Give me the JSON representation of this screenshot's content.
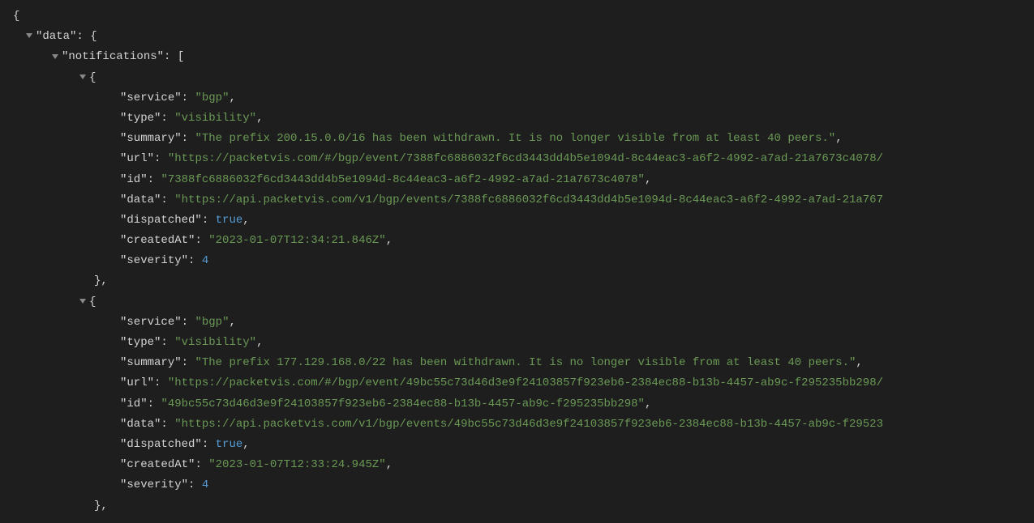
{
  "root_key": "data",
  "notifications_key": "notifications",
  "keys": {
    "service": "service",
    "type": "type",
    "summary": "summary",
    "url": "url",
    "id": "id",
    "data": "data",
    "dispatched": "dispatched",
    "createdAt": "createdAt",
    "severity": "severity"
  },
  "notifications": [
    {
      "service": "bgp",
      "type": "visibility",
      "summary": "The prefix 200.15.0.0/16 has been withdrawn. It is no longer visible from at least 40 peers.",
      "url": "https://packetvis.com/#/bgp/event/7388fc6886032f6cd3443dd4b5e1094d-8c44eac3-a6f2-4992-a7ad-21a7673c4078/",
      "id": "7388fc6886032f6cd3443dd4b5e1094d-8c44eac3-a6f2-4992-a7ad-21a7673c4078",
      "data": "https://api.packetvis.com/v1/bgp/events/7388fc6886032f6cd3443dd4b5e1094d-8c44eac3-a6f2-4992-a7ad-21a767",
      "dispatched": "true",
      "createdAt": "2023-01-07T12:34:21.846Z",
      "severity": "4"
    },
    {
      "service": "bgp",
      "type": "visibility",
      "summary": "The prefix 177.129.168.0/22 has been withdrawn. It is no longer visible from at least 40 peers.",
      "url": "https://packetvis.com/#/bgp/event/49bc55c73d46d3e9f24103857f923eb6-2384ec88-b13b-4457-ab9c-f295235bb298/",
      "id": "49bc55c73d46d3e9f24103857f923eb6-2384ec88-b13b-4457-ab9c-f295235bb298",
      "data": "https://api.packetvis.com/v1/bgp/events/49bc55c73d46d3e9f24103857f923eb6-2384ec88-b13b-4457-ab9c-f29523",
      "dispatched": "true",
      "createdAt": "2023-01-07T12:33:24.945Z",
      "severity": "4"
    }
  ]
}
